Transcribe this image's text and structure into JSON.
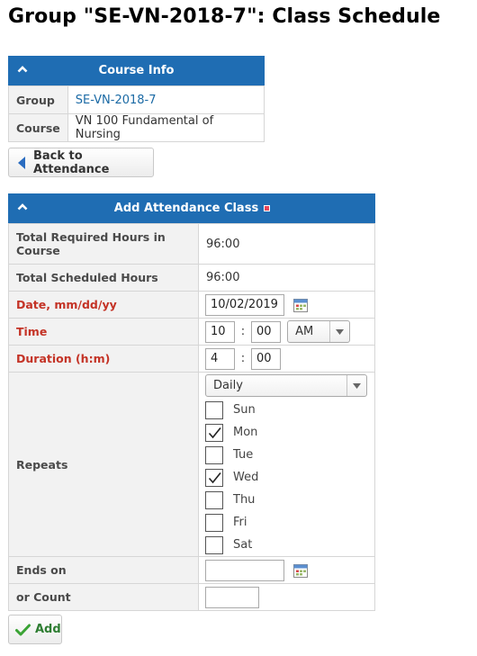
{
  "page": {
    "title": "Group \"SE-VN-2018-7\": Class Schedule"
  },
  "course_info": {
    "header": "Course Info",
    "rows": [
      {
        "label": "Group",
        "value": "SE-VN-2018-7"
      },
      {
        "label": "Course",
        "value": "VN 100 Fundamental of Nursing"
      }
    ]
  },
  "back_button": {
    "label": "Back to Attendance"
  },
  "form": {
    "header": "Add Attendance Class",
    "total_required_label": "Total Required Hours in Course",
    "total_required_value": "96:00",
    "total_scheduled_label": "Total Scheduled Hours",
    "total_scheduled_value": "96:00",
    "date_label": "Date, mm/dd/yy",
    "date_value": "10/02/2019",
    "time_label": "Time",
    "time_hour": "10",
    "time_minute": "00",
    "time_ampm": "AM",
    "duration_label": "Duration (h:m)",
    "duration_hours": "4",
    "duration_minutes": "00",
    "repeats_label": "Repeats",
    "repeats_value": "Daily",
    "days": [
      {
        "name": "Sun",
        "checked": false
      },
      {
        "name": "Mon",
        "checked": true
      },
      {
        "name": "Tue",
        "checked": false
      },
      {
        "name": "Wed",
        "checked": true
      },
      {
        "name": "Thu",
        "checked": false
      },
      {
        "name": "Fri",
        "checked": false
      },
      {
        "name": "Sat",
        "checked": false
      }
    ],
    "ends_on_label": "Ends on",
    "ends_on_value": "",
    "count_label": "or Count",
    "count_value": ""
  },
  "add_button": {
    "label": "Add"
  },
  "colors": {
    "header_blue": "#1f6db3",
    "required_red": "#c43326",
    "link_blue": "#1b6aa5",
    "check_green": "#3aa335"
  }
}
